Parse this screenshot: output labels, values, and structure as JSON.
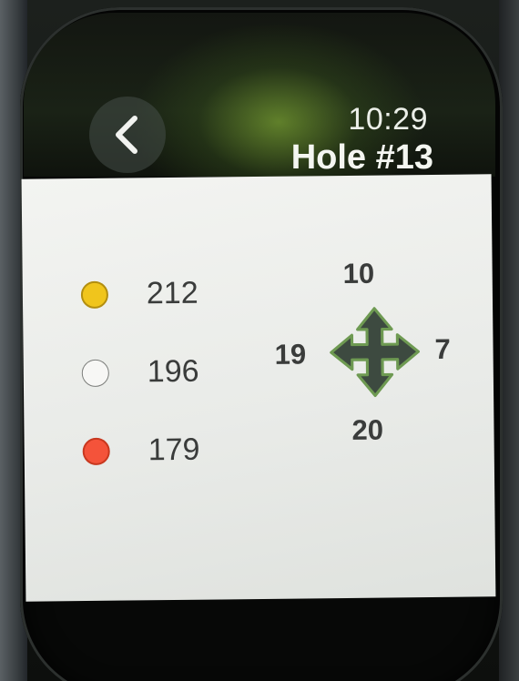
{
  "header": {
    "back_icon": "chevron-left-icon",
    "time": "10:29",
    "hole_title": "Hole #13"
  },
  "distances": [
    {
      "marker": "gold",
      "color": "#f0c51c",
      "value": "212"
    },
    {
      "marker": "white",
      "color": "#f7f7f5",
      "value": "196"
    },
    {
      "marker": "red",
      "color": "#f4533a",
      "value": "179"
    }
  ],
  "wind": {
    "icon": "move-arrows-icon",
    "top": "10",
    "left": "19",
    "right": "7",
    "bottom": "20"
  },
  "colors": {
    "screen_bg": "#eceee9",
    "text": "#3a3c3b",
    "arrow_fill": "#3d4a40",
    "arrow_outline": "#6e9a52"
  }
}
